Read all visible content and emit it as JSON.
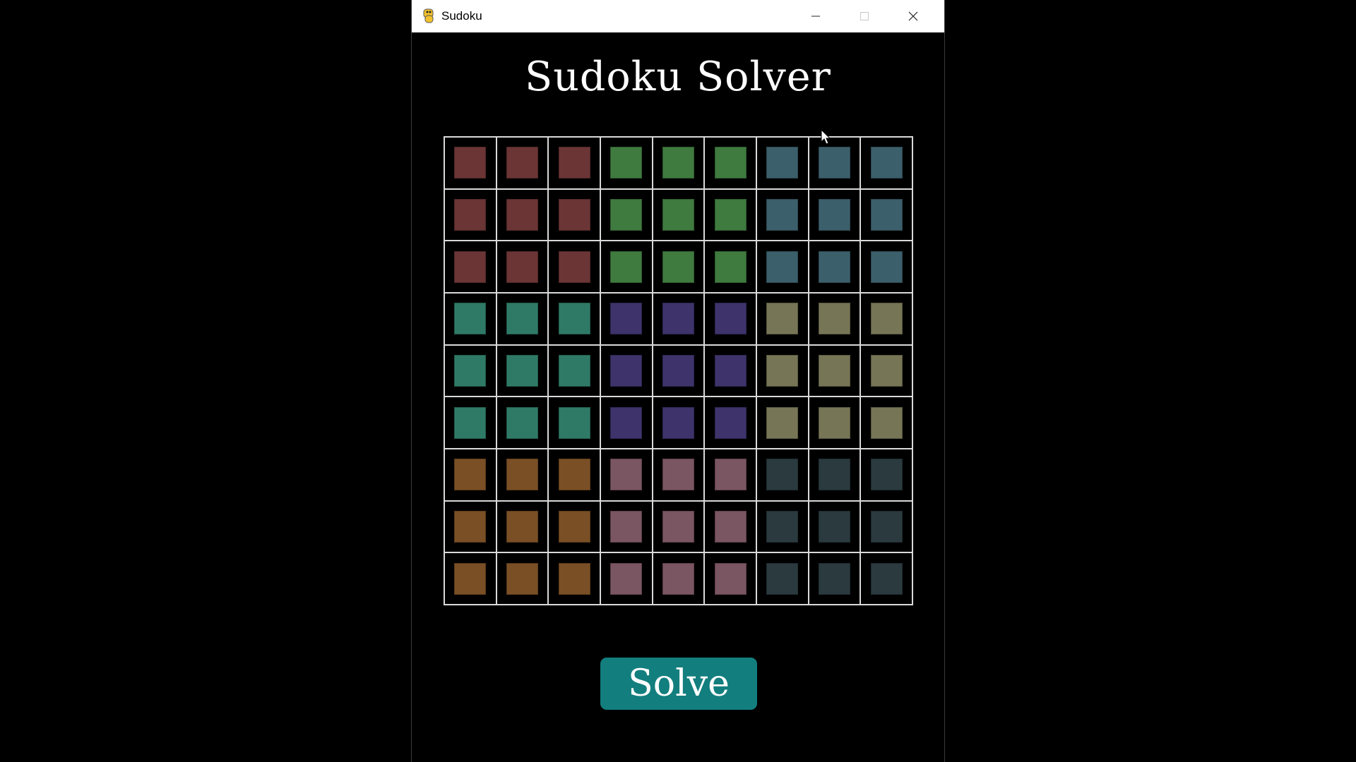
{
  "window": {
    "title": "Sudoku",
    "icon": "python-snake-icon"
  },
  "heading": "Sudoku Solver",
  "solve_button": {
    "label": "Solve",
    "color": "#137e7e"
  },
  "board": {
    "rows": 9,
    "cols": 9,
    "box_colors": [
      [
        "#6b3535",
        "#3f7a3f",
        "#3b5f6b"
      ],
      [
        "#2f7a66",
        "#3e336b",
        "#767556"
      ],
      [
        "#7a4f25",
        "#7a5562",
        "#2a3a3f"
      ]
    ],
    "grid_line_color": "#d9d9d9",
    "values": [
      [
        "",
        "",
        "",
        "",
        "",
        "",
        "",
        "",
        ""
      ],
      [
        "",
        "",
        "",
        "",
        "",
        "",
        "",
        "",
        ""
      ],
      [
        "",
        "",
        "",
        "",
        "",
        "",
        "",
        "",
        ""
      ],
      [
        "",
        "",
        "",
        "",
        "",
        "",
        "",
        "",
        ""
      ],
      [
        "",
        "",
        "",
        "",
        "",
        "",
        "",
        "",
        ""
      ],
      [
        "",
        "",
        "",
        "",
        "",
        "",
        "",
        "",
        ""
      ],
      [
        "",
        "",
        "",
        "",
        "",
        "",
        "",
        "",
        ""
      ],
      [
        "",
        "",
        "",
        "",
        "",
        "",
        "",
        "",
        ""
      ],
      [
        "",
        "",
        "",
        "",
        "",
        "",
        "",
        "",
        ""
      ]
    ]
  }
}
